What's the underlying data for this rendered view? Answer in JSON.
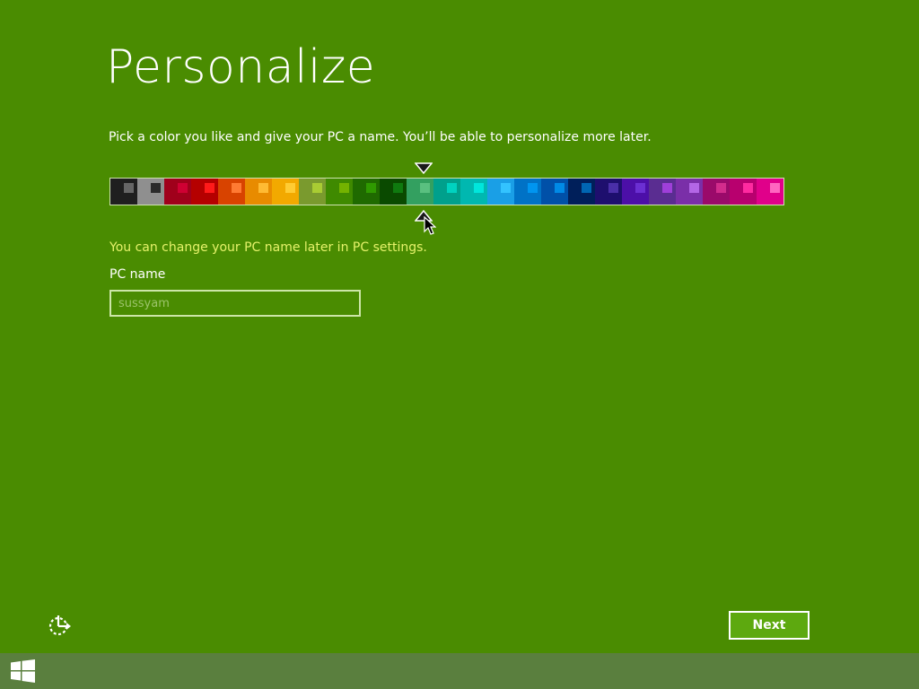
{
  "header": {
    "title": "Personalize"
  },
  "intro": {
    "text": "Pick a color you like and give your PC a name. You’ll be able to personalize more later."
  },
  "palette": {
    "selected_index": 11,
    "swatches": [
      {
        "bg": "#1f1f1f",
        "accent": "#666666"
      },
      {
        "bg": "#8f8f8f",
        "accent": "#2b2b2b"
      },
      {
        "bg": "#a0001b",
        "accent": "#cf0033"
      },
      {
        "bg": "#b50000",
        "accent": "#ff1a1a"
      },
      {
        "bg": "#d84300",
        "accent": "#ff7a33"
      },
      {
        "bg": "#e88b00",
        "accent": "#ffbb33"
      },
      {
        "bg": "#f2a900",
        "accent": "#ffcc33"
      },
      {
        "bg": "#7a9a2e",
        "accent": "#a9cc33"
      },
      {
        "bg": "#3f8a00",
        "accent": "#74b300"
      },
      {
        "bg": "#1f6a00",
        "accent": "#2f9a00"
      },
      {
        "bg": "#0a4a00",
        "accent": "#0f7a0f"
      },
      {
        "bg": "#33a060",
        "accent": "#5ac080"
      },
      {
        "bg": "#00a08c",
        "accent": "#00d2c0"
      },
      {
        "bg": "#00b8b0",
        "accent": "#00e6dc"
      },
      {
        "bg": "#1a9fe6",
        "accent": "#33c3ff"
      },
      {
        "bg": "#0072c6",
        "accent": "#0095f0"
      },
      {
        "bg": "#0050a8",
        "accent": "#008ae6"
      },
      {
        "bg": "#001f5a",
        "accent": "#0066b3"
      },
      {
        "bg": "#1e0f6e",
        "accent": "#4a2fa8"
      },
      {
        "bg": "#4c0fa8",
        "accent": "#6b2fd2"
      },
      {
        "bg": "#5a2d91",
        "accent": "#9f3fd9"
      },
      {
        "bg": "#7a2fa8",
        "accent": "#b366e6"
      },
      {
        "bg": "#9a0a6a",
        "accent": "#d22c8c"
      },
      {
        "bg": "#b8006e",
        "accent": "#ff2aa0"
      },
      {
        "bg": "#e0008a",
        "accent": "#ff66c0"
      }
    ]
  },
  "pc_name": {
    "note": "You can change your PC name later in PC settings.",
    "label": "PC name",
    "placeholder": "sussyam",
    "value": ""
  },
  "footer": {
    "next_label": "Next"
  },
  "icons": {
    "ease_of_access": "ease-of-access-icon",
    "start": "windows-start-icon"
  }
}
